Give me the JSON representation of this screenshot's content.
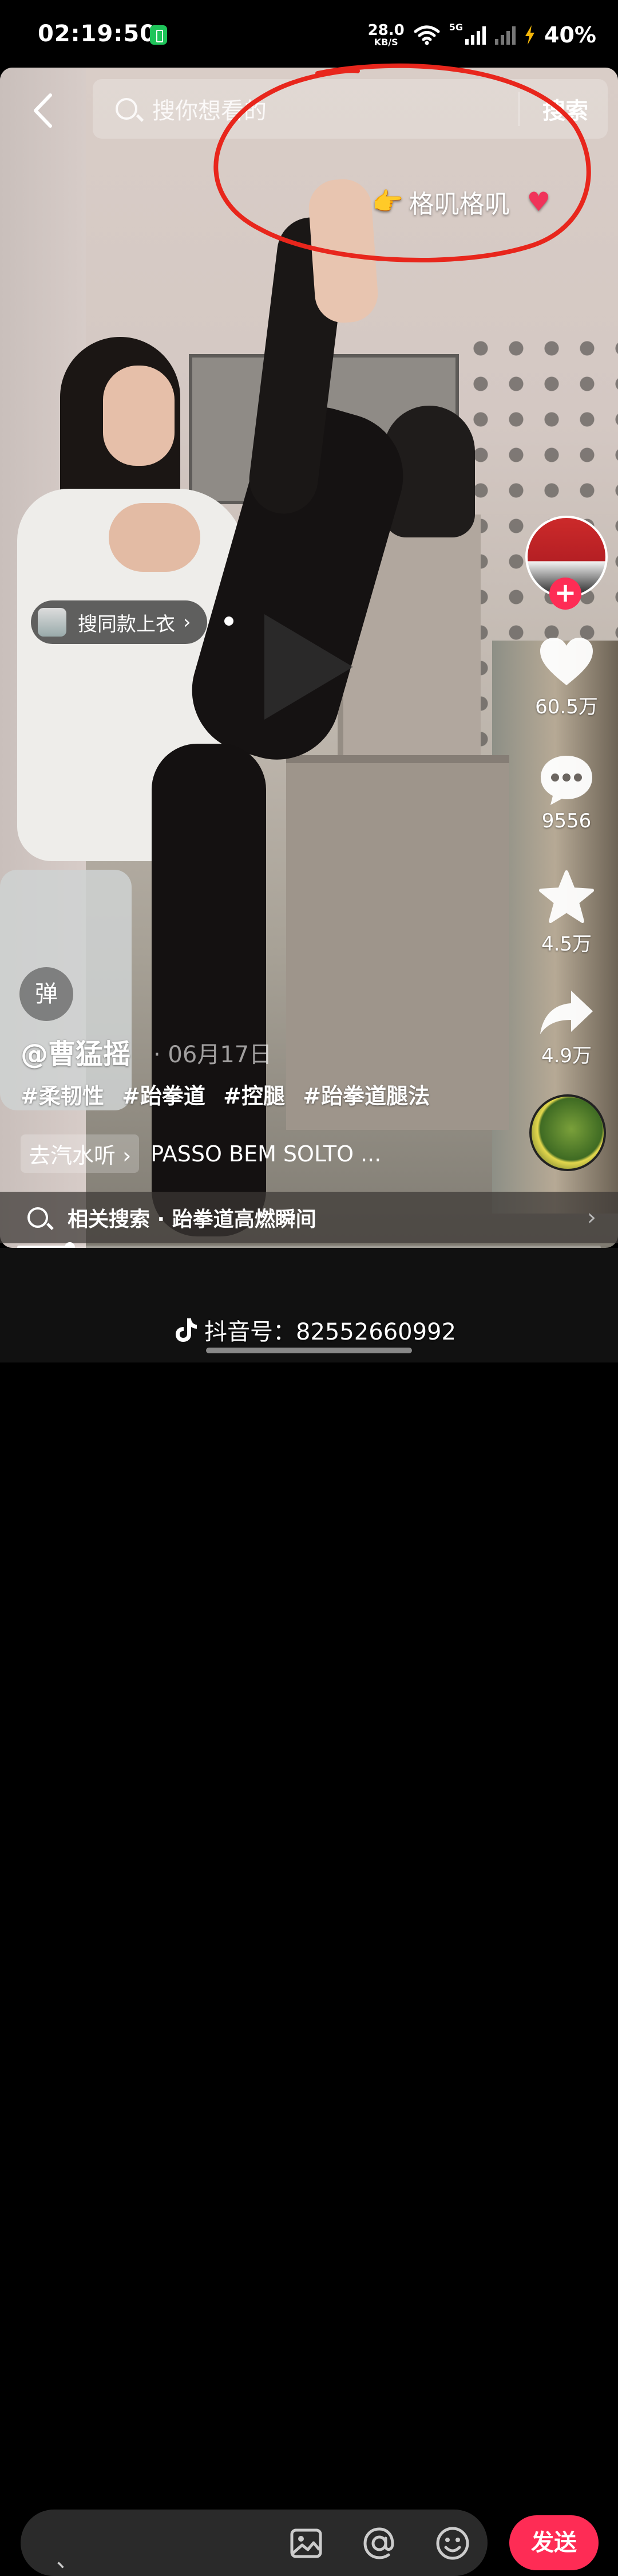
{
  "status_bar": {
    "time": "02:19:50",
    "net_speed_value": "28.0",
    "net_speed_unit": "KB/S",
    "net_type": "5G",
    "battery": "40%"
  },
  "search": {
    "placeholder": "搜你想看的",
    "button_label": "搜索"
  },
  "overlay": {
    "text": "格叽格叽",
    "pointer_emoji": "👉",
    "heart": "♥"
  },
  "product_tag": {
    "label": "搜同款上衣",
    "chevron": "›"
  },
  "actions": {
    "like_count": "60.5万",
    "comment_count": "9556",
    "favorite_count": "4.5万",
    "share_count": "4.9万",
    "follow_symbol": "+"
  },
  "danmu_label": "弹",
  "post": {
    "author": "@曹猛摇",
    "date": "· 06月17日",
    "hashtags": [
      "#柔韧性",
      "#跆拳道",
      "#控腿",
      "#跆拳道腿法"
    ],
    "music_chip": "去汽水听 ›",
    "music_title": "PASSO BEM SOLTO ..."
  },
  "related_search": {
    "label": "相关搜索 · 跆拳道高燃瞬间",
    "arrow": "›"
  },
  "progress": {
    "fraction": 0.09
  },
  "comment_bar": {
    "cursor_char": "、",
    "send_label": "发送"
  },
  "watermark": {
    "douyin_id": "抖音号：82552660992"
  },
  "colors": {
    "accent": "#fe2c55",
    "annotation_circle": "#e8261c",
    "battery_icon": "#1fc45a"
  },
  "icons": {
    "back": "chevron-left-icon",
    "search": "search-icon",
    "like": "heart-icon",
    "comment": "comment-bubble-icon",
    "favorite": "star-icon",
    "share": "share-arrow-icon",
    "image": "image-icon",
    "mention": "at-icon",
    "emoji": "emoji-icon"
  }
}
